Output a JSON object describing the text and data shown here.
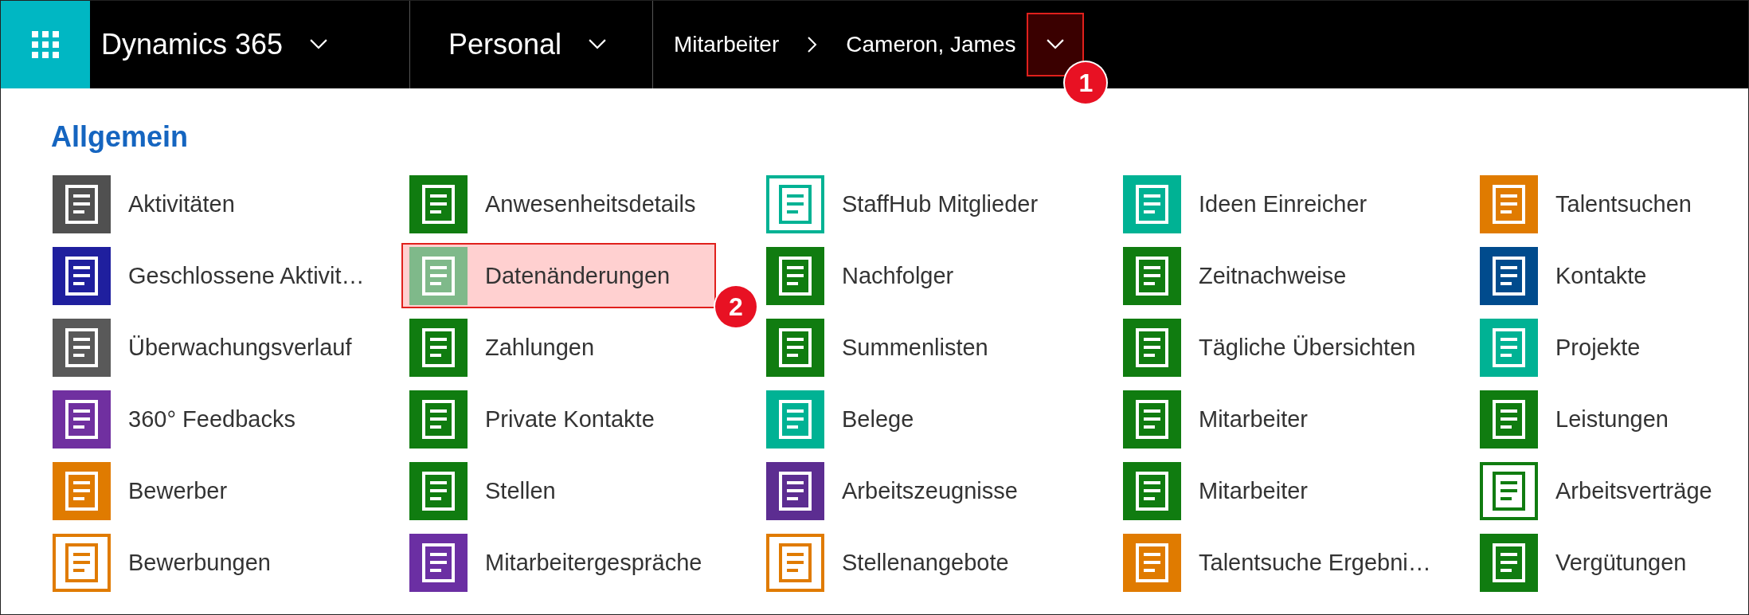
{
  "top_bar": {
    "app_name": "Dynamics 365",
    "module": "Personal",
    "breadcrumb": [
      "Mitarbeiter",
      "Cameron, James"
    ],
    "record_menu": {
      "highlighted": true,
      "callout": "1"
    }
  },
  "section": {
    "title": "Allgemein",
    "items": [
      {
        "label": "Aktivitäten",
        "color": "#505050",
        "outline": false,
        "highlighted": false
      },
      {
        "label": "Anwesenheitsdetails",
        "color": "#107c10",
        "outline": false,
        "highlighted": false
      },
      {
        "label": "StaffHub Mitglieder",
        "color": "#00b294",
        "outline": true,
        "highlighted": false
      },
      {
        "label": "Ideen Einreicher",
        "color": "#00b294",
        "outline": false,
        "highlighted": false
      },
      {
        "label": "Talentsuchen",
        "color": "#e07b00",
        "outline": false,
        "highlighted": false
      },
      {
        "label": "Geschlossene Aktivit…",
        "color": "#1f1f9e",
        "outline": false,
        "highlighted": false
      },
      {
        "label": "Datenänderungen",
        "color": "#7fb98a",
        "outline": false,
        "highlighted": true,
        "callout": "2"
      },
      {
        "label": "Nachfolger",
        "color": "#107c10",
        "outline": false,
        "highlighted": false
      },
      {
        "label": "Zeitnachweise",
        "color": "#107c10",
        "outline": false,
        "highlighted": false
      },
      {
        "label": "Kontakte",
        "color": "#004b8d",
        "outline": false,
        "highlighted": false
      },
      {
        "label": "Überwachungsverlauf",
        "color": "#595959",
        "outline": false,
        "highlighted": false
      },
      {
        "label": "Zahlungen",
        "color": "#107c10",
        "outline": false,
        "highlighted": false
      },
      {
        "label": "Summenlisten",
        "color": "#107c10",
        "outline": false,
        "highlighted": false
      },
      {
        "label": "Tägliche Übersichten",
        "color": "#107c10",
        "outline": false,
        "highlighted": false
      },
      {
        "label": "Projekte",
        "color": "#00b294",
        "outline": false,
        "highlighted": false
      },
      {
        "label": "360° Feedbacks",
        "color": "#7030a0",
        "outline": false,
        "highlighted": false
      },
      {
        "label": "Private Kontakte",
        "color": "#107c10",
        "outline": false,
        "highlighted": false
      },
      {
        "label": "Belege",
        "color": "#00b294",
        "outline": false,
        "highlighted": false
      },
      {
        "label": "Mitarbeiter",
        "color": "#107c10",
        "outline": false,
        "highlighted": false
      },
      {
        "label": "Leistungen",
        "color": "#107c10",
        "outline": false,
        "highlighted": false
      },
      {
        "label": "Bewerber",
        "color": "#e07b00",
        "outline": false,
        "highlighted": false
      },
      {
        "label": "Stellen",
        "color": "#107c10",
        "outline": false,
        "highlighted": false
      },
      {
        "label": "Arbeitszeugnisse",
        "color": "#5c2d91",
        "outline": false,
        "highlighted": false
      },
      {
        "label": "Mitarbeiter",
        "color": "#107c10",
        "outline": false,
        "highlighted": false
      },
      {
        "label": "Arbeitsverträge",
        "color": "#107c10",
        "outline": true,
        "highlighted": false
      },
      {
        "label": "Bewerbungen",
        "color": "#e07b00",
        "outline": true,
        "highlighted": false
      },
      {
        "label": "Mitarbeitergespräche",
        "color": "#6b2fa3",
        "outline": false,
        "highlighted": false
      },
      {
        "label": "Stellenangebote",
        "color": "#e07b00",
        "outline": true,
        "highlighted": false
      },
      {
        "label": "Talentsuche Ergebni…",
        "color": "#e07b00",
        "outline": false,
        "highlighted": false
      },
      {
        "label": "Vergütungen",
        "color": "#107c10",
        "outline": false,
        "highlighted": false
      }
    ]
  }
}
